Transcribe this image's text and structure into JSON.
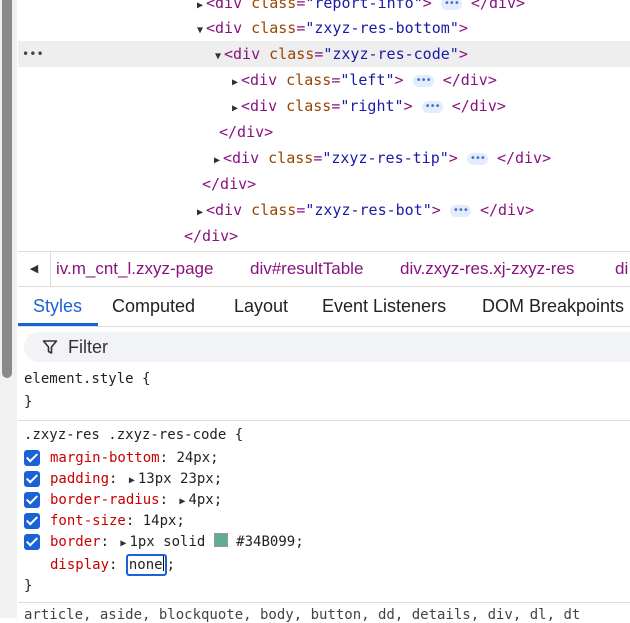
{
  "dom_tree": {
    "line0": {
      "tag_open": "<div ",
      "attr": "class",
      "eq": "=",
      "value": "\"report-info\"",
      "close": ">",
      "pill": "•••",
      "end_tag": "</div>"
    },
    "line1": {
      "tag_open": "<div ",
      "attr": "class",
      "eq": "=",
      "value": "\"zxyz-res-bottom\"",
      "close": ">"
    },
    "line2": {
      "tag_open": "<div ",
      "attr": "class",
      "eq": "=",
      "value": "\"zxyz-res-code\"",
      "close": ">",
      "dots": "•••"
    },
    "line3": {
      "tag_open": "<div ",
      "attr": "class",
      "eq": "=",
      "value": "\"left\"",
      "close": ">",
      "pill": "•••",
      "end_tag": "</div>"
    },
    "line4": {
      "tag_open": "<div ",
      "attr": "class",
      "eq": "=",
      "value": "\"right\"",
      "close": ">",
      "pill": "•••",
      "end_tag": "</div>"
    },
    "line5": {
      "end_tag": "</div>"
    },
    "line6": {
      "tag_open": "<div ",
      "attr": "class",
      "eq": "=",
      "value": "\"zxyz-res-tip\"",
      "close": ">",
      "pill": "•••",
      "end_tag": "</div>"
    },
    "line7": {
      "end_tag": "</div>"
    },
    "line8": {
      "tag_open": "<div ",
      "attr": "class",
      "eq": "=",
      "value": "\"zxyz-res-bot\"",
      "close": ">",
      "pill": "•••",
      "end_tag": "</div>"
    },
    "line9": {
      "end_tag": "</div>"
    }
  },
  "breadcrumbs": [
    "iv.m_cnt_l.zxyz-page",
    "div#resultTable",
    "div.zxyz-res.xj-zxyz-res",
    "di"
  ],
  "tabs": [
    "Styles",
    "Computed",
    "Layout",
    "Event Listeners",
    "DOM Breakpoints"
  ],
  "filter": {
    "label": "Filter"
  },
  "styles": {
    "element_style": {
      "selector": "element.style {",
      "close": "}"
    },
    "rule": {
      "selector": ".zxyz-res .zxyz-res-code {",
      "close": "}",
      "props": [
        {
          "name": "margin-bottom",
          "value": "24px;"
        },
        {
          "name": "padding",
          "value": "13px 23px;"
        },
        {
          "name": "border-radius",
          "value": "4px;"
        },
        {
          "name": "font-size",
          "value": "14px;"
        },
        {
          "name": "border",
          "value_a": "1px solid ",
          "color_text": "#34B099",
          "value_b": ";"
        },
        {
          "name": "display",
          "value": "none",
          "after": ";"
        }
      ]
    },
    "swatch_color": "#5fae8f"
  },
  "element_chips": "article, aside, blockquote, body, button, dd, details, div, dl, dt"
}
